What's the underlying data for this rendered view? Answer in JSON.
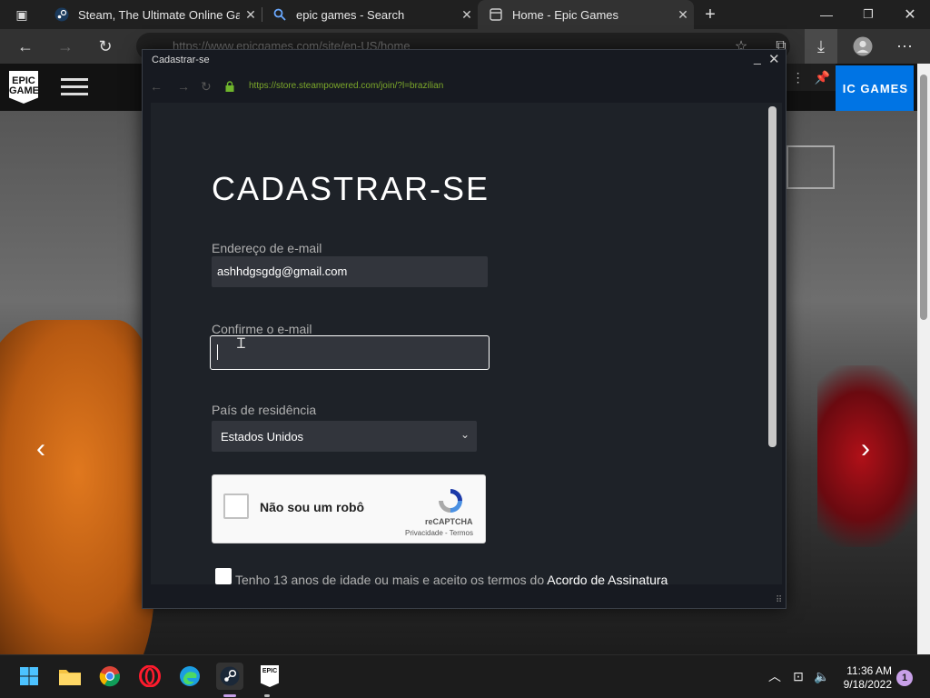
{
  "browser": {
    "tabs": [
      {
        "title": "Steam, The Ultimate Online Gam",
        "icon": "steam-icon"
      },
      {
        "title": "epic games - Search",
        "icon": "search-icon"
      },
      {
        "title": "Home - Epic Games",
        "icon": "page-icon",
        "active": true
      }
    ],
    "address_url": "https://www.epicgames.com/site/en-US/home"
  },
  "epic": {
    "logo_text": "EPIC GAMES",
    "get_button": "IC GAMES"
  },
  "popup": {
    "title": "Cadastrar-se",
    "url": "https://store.steampowered.com/join/?l=brazilian",
    "form": {
      "heading": "CADASTRAR-SE",
      "email_label": "Endereço de e-mail",
      "email_value": "ashhdgsgdg@gmail.com",
      "confirm_label": "Confirme o e-mail",
      "confirm_value": "",
      "country_label": "País de residência",
      "country_value": "Estados Unidos",
      "captcha_label": "Não sou um robô",
      "captcha_brand": "reCAPTCHA",
      "captcha_links": "Privacidade - Termos",
      "age_text": "Tenho 13 anos de idade ou mais e aceito os termos do",
      "age_link": "Acordo de Assinatura"
    }
  },
  "taskbar": {
    "time": "11:36 AM",
    "date": "9/18/2022",
    "notifications": "1",
    "apps": [
      "start-icon",
      "file-explorer-icon",
      "chrome-icon",
      "opera-icon",
      "edge-icon",
      "steam-icon",
      "epic-games-icon"
    ]
  },
  "colors": {
    "steam_bg": "#171a21",
    "steam_content": "#1e2228",
    "steam_input": "#32353c",
    "epic_blue": "#0074e4",
    "url_green": "#7ca82a"
  }
}
